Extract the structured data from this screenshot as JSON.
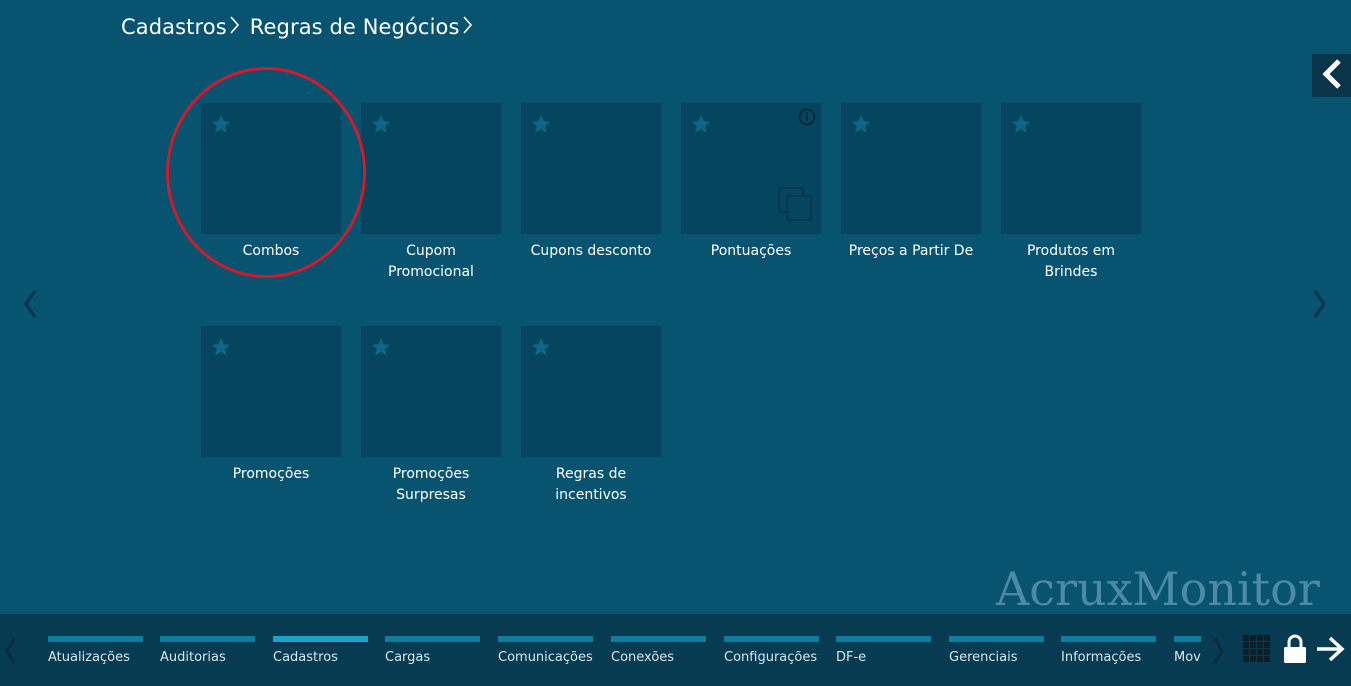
{
  "breadcrumb": {
    "items": [
      "Cadastros",
      "Regras de Negócios"
    ],
    "separator": ">"
  },
  "tiles": [
    {
      "label": "Combos",
      "star": true,
      "info": false,
      "copy": false,
      "highlighted": true
    },
    {
      "label": "Cupom Promocional",
      "star": true,
      "info": false,
      "copy": false
    },
    {
      "label": "Cupons desconto",
      "star": true,
      "info": false,
      "copy": false
    },
    {
      "label": "Pontuações",
      "star": true,
      "info": true,
      "copy": true
    },
    {
      "label": "Preços a Partir De",
      "star": true,
      "info": false,
      "copy": false
    },
    {
      "label": "Produtos em Brindes",
      "star": true,
      "info": false,
      "copy": false
    },
    {
      "label": "Promoções",
      "star": true,
      "info": false,
      "copy": false
    },
    {
      "label": "Promoções Surpresas",
      "star": true,
      "info": false,
      "copy": false
    },
    {
      "label": "Regras de incentivos",
      "star": true,
      "info": false,
      "copy": false
    }
  ],
  "watermark": "AcruxMonitor",
  "bottom_nav": {
    "items": [
      "Atualizações",
      "Auditorias",
      "Cadastros",
      "Cargas",
      "Comunicações",
      "Conexões",
      "Configurações",
      "DF-e",
      "Gerenciais",
      "Informações",
      "Mov"
    ],
    "active": "Cadastros"
  },
  "icons": {
    "collapse": "chevron-left-icon",
    "prev": "chevron-left-icon",
    "next": "chevron-right-icon",
    "grid": "grid-icon",
    "lock": "lock-icon",
    "logout": "arrow-right-icon",
    "favorite": "star-icon",
    "info": "info-icon",
    "copy": "copy-icon"
  },
  "colors": {
    "background": "#075370",
    "tile": "#064560",
    "bottom_bar": "#063b52",
    "nav_line": "#0f7d9e",
    "nav_line_active": "#1aa3c8",
    "highlight": "#d11b2b"
  }
}
